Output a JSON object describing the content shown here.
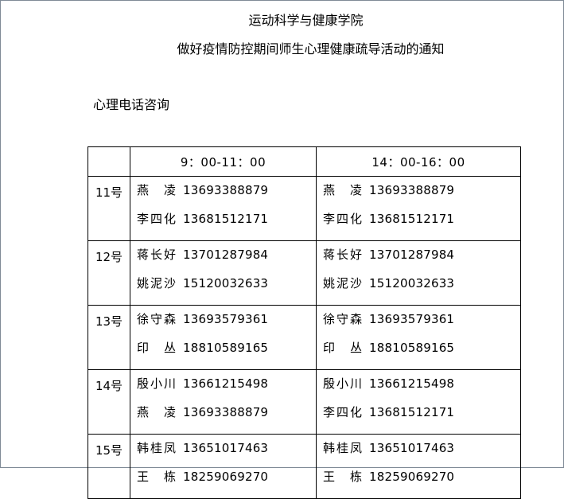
{
  "document": {
    "school_name": "运动科学与健康学院",
    "notice_title": "做好疫情防控期间师生心理健康疏导活动的通知",
    "section_label": "心理电话咨询"
  },
  "table": {
    "headers": {
      "day": "",
      "morning": "9：00-11：00",
      "afternoon": "14：00-16：00"
    },
    "rows": [
      {
        "day": "11号",
        "morning": [
          {
            "name": "燕　凌",
            "phone": "13693388879"
          },
          {
            "name": "李四化",
            "phone": "13681512171"
          }
        ],
        "afternoon": [
          {
            "name": "燕　凌",
            "phone": "13693388879"
          },
          {
            "name": "李四化",
            "phone": "13681512171"
          }
        ]
      },
      {
        "day": "12号",
        "morning": [
          {
            "name": "蒋长好",
            "phone": "13701287984"
          },
          {
            "name": "姚泥沙",
            "phone": "15120032633"
          }
        ],
        "afternoon": [
          {
            "name": "蒋长好",
            "phone": "13701287984"
          },
          {
            "name": "姚泥沙",
            "phone": "15120032633"
          }
        ]
      },
      {
        "day": "13号",
        "morning": [
          {
            "name": "徐守森",
            "phone": "13693579361"
          },
          {
            "name": "印　丛",
            "phone": "18810589165"
          }
        ],
        "afternoon": [
          {
            "name": "徐守森",
            "phone": "13693579361"
          },
          {
            "name": "印　丛",
            "phone": "18810589165"
          }
        ]
      },
      {
        "day": "14号",
        "morning": [
          {
            "name": "殷小川",
            "phone": "13661215498"
          },
          {
            "name": "燕　凌",
            "phone": "13693388879"
          }
        ],
        "afternoon": [
          {
            "name": "殷小川",
            "phone": "13661215498"
          },
          {
            "name": "李四化",
            "phone": "13681512171"
          }
        ]
      },
      {
        "day": "15号",
        "morning": [
          {
            "name": "韩桂凤",
            "phone": "13651017463"
          },
          {
            "name": "王　栋",
            "phone": "18259069270"
          }
        ],
        "afternoon": [
          {
            "name": "韩桂凤",
            "phone": "13651017463"
          },
          {
            "name": "王　栋",
            "phone": "18259069270"
          }
        ]
      }
    ]
  }
}
